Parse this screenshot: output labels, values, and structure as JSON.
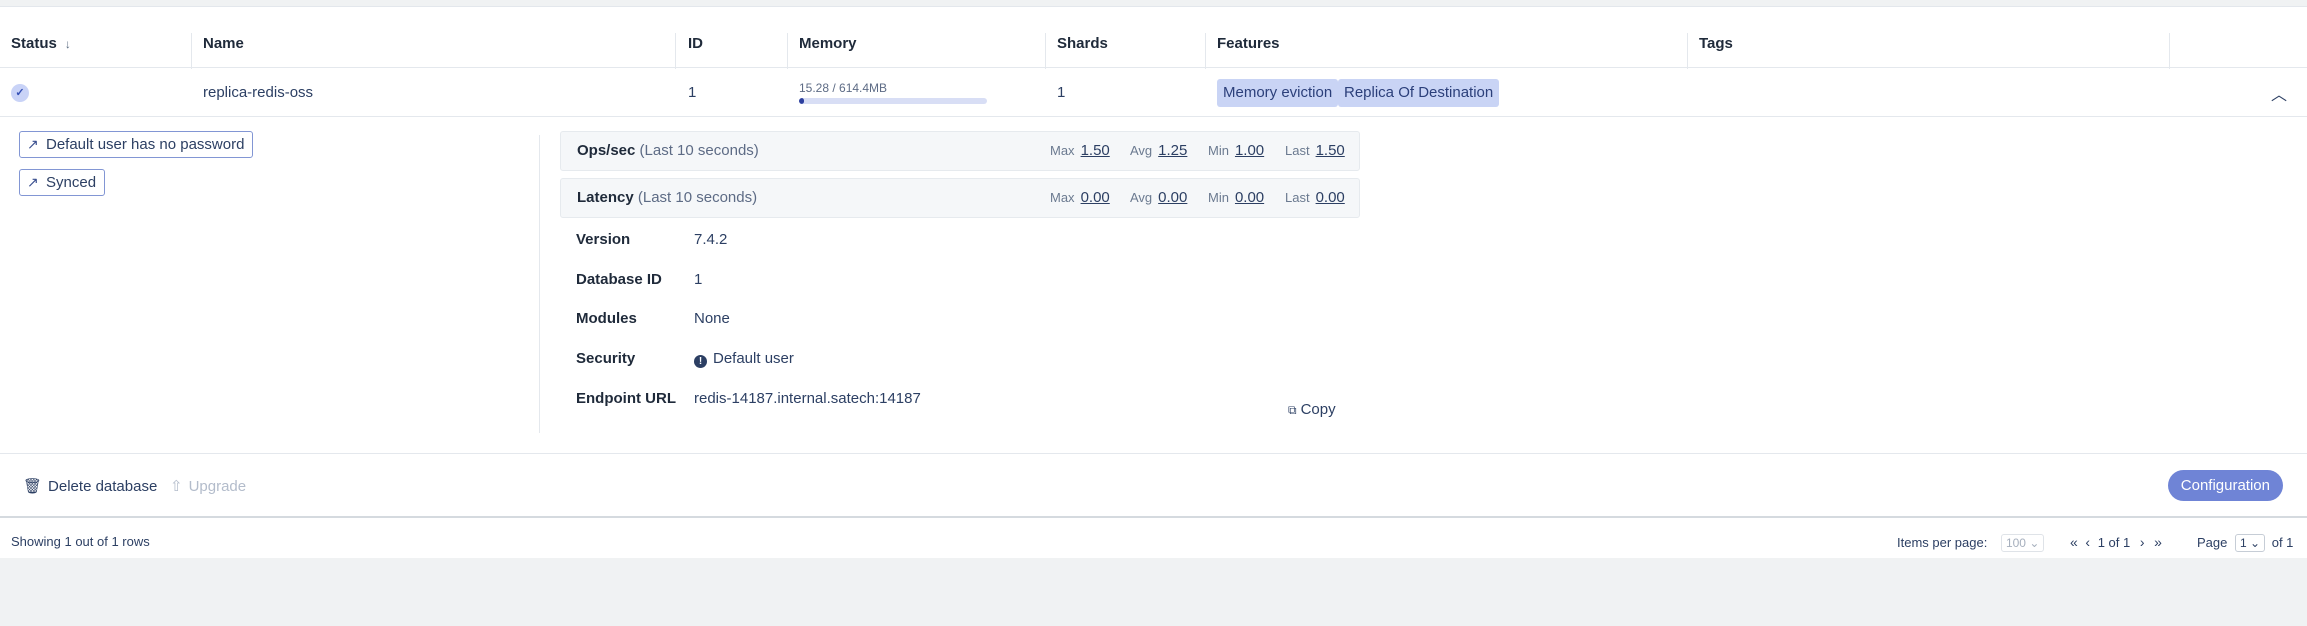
{
  "table": {
    "headers": {
      "status": "Status",
      "name": "Name",
      "id": "ID",
      "memory": "Memory",
      "shards": "Shards",
      "features": "Features",
      "tags": "Tags"
    },
    "row": {
      "name": "replica-redis-oss",
      "id": "1",
      "memory_text": "15.28 / 614.4MB",
      "memory_fraction": 0.025,
      "shards": "1",
      "features": [
        "Memory eviction",
        "Replica Of Destination"
      ]
    }
  },
  "alerts": [
    "Default user has no password",
    "Synced"
  ],
  "metrics": [
    {
      "title": "Ops/sec",
      "subtitle": "(Last 10 seconds)",
      "max_label": "Max",
      "max": "1.50",
      "avg_label": "Avg",
      "avg": "1.25",
      "min_label": "Min",
      "min": "1.00",
      "last_label": "Last",
      "last": "1.50"
    },
    {
      "title": "Latency",
      "subtitle": "(Last 10 seconds)",
      "max_label": "Max",
      "max": "0.00",
      "avg_label": "Avg",
      "avg": "0.00",
      "min_label": "Min",
      "min": "0.00",
      "last_label": "Last",
      "last": "0.00"
    }
  ],
  "details": {
    "version_label": "Version",
    "version": "7.4.2",
    "dbid_label": "Database ID",
    "dbid": "1",
    "modules_label": "Modules",
    "modules": "None",
    "security_label": "Security",
    "security": "Default user",
    "endpoint_label": "Endpoint URL",
    "endpoint": "redis-14187.internal.satech:14187",
    "copy_label": "Copy"
  },
  "actions": {
    "delete": "Delete database",
    "upgrade": "Upgrade",
    "configuration": "Configuration"
  },
  "pagination": {
    "showing": "Showing 1 out of 1 rows",
    "items_per_page_label": "Items per page:",
    "items_per_page": "100",
    "range": "1 of 1",
    "page_label": "Page",
    "page": "1",
    "of_total": "of 1"
  },
  "colors": {
    "accent": "#6f84d6",
    "badge_bg": "#c9d4f5",
    "text": "#2c3f63"
  }
}
